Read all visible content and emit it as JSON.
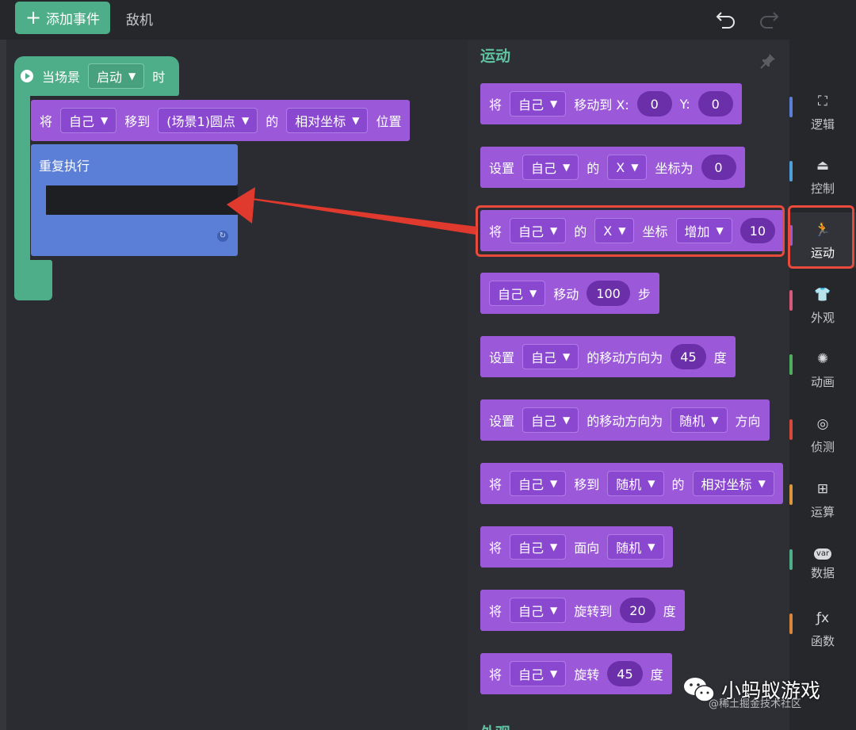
{
  "topbar": {
    "add_event_label": "添加事件",
    "sprite_tab": "敌机"
  },
  "workspace": {
    "event_block": {
      "prefix": "当场景",
      "dropdown": "启动",
      "suffix": "时"
    },
    "move_block": {
      "w1": "将",
      "target": "自己",
      "w2": "移到",
      "dest": "(场景1)圆点",
      "w3": "的",
      "coord": "相对坐标",
      "w4": "位置"
    },
    "repeat_block": {
      "label": "重复执行"
    }
  },
  "palette": {
    "title": "运动",
    "footer": "外观",
    "blocks": [
      {
        "parts": [
          {
            "t": "txt",
            "v": "将"
          },
          {
            "t": "dd",
            "v": "自己"
          },
          {
            "t": "txt",
            "v": "移动到 X:"
          },
          {
            "t": "num",
            "v": "0"
          },
          {
            "t": "txt",
            "v": "Y:"
          },
          {
            "t": "num",
            "v": "0"
          }
        ]
      },
      {
        "parts": [
          {
            "t": "txt",
            "v": "设置"
          },
          {
            "t": "dd",
            "v": "自己"
          },
          {
            "t": "txt",
            "v": "的"
          },
          {
            "t": "dd",
            "v": "X"
          },
          {
            "t": "txt",
            "v": "坐标为"
          },
          {
            "t": "num",
            "v": "0"
          }
        ]
      },
      {
        "parts": [
          {
            "t": "txt",
            "v": "将"
          },
          {
            "t": "dd",
            "v": "自己"
          },
          {
            "t": "txt",
            "v": "的"
          },
          {
            "t": "dd",
            "v": "X"
          },
          {
            "t": "txt",
            "v": "坐标"
          },
          {
            "t": "dd",
            "v": "增加"
          },
          {
            "t": "num",
            "v": "10"
          }
        ]
      },
      {
        "parts": [
          {
            "t": "dd",
            "v": "自己"
          },
          {
            "t": "txt",
            "v": "移动"
          },
          {
            "t": "num",
            "v": "100"
          },
          {
            "t": "txt",
            "v": "步"
          }
        ]
      },
      {
        "parts": [
          {
            "t": "txt",
            "v": "设置"
          },
          {
            "t": "dd",
            "v": "自己"
          },
          {
            "t": "txt",
            "v": "的移动方向为"
          },
          {
            "t": "num",
            "v": "45"
          },
          {
            "t": "txt",
            "v": "度"
          }
        ]
      },
      {
        "parts": [
          {
            "t": "txt",
            "v": "设置"
          },
          {
            "t": "dd",
            "v": "自己"
          },
          {
            "t": "txt",
            "v": "的移动方向为"
          },
          {
            "t": "dd",
            "v": "随机"
          },
          {
            "t": "txt",
            "v": "方向"
          }
        ]
      },
      {
        "parts": [
          {
            "t": "txt",
            "v": "将"
          },
          {
            "t": "dd",
            "v": "自己"
          },
          {
            "t": "txt",
            "v": "移到"
          },
          {
            "t": "dd",
            "v": "随机"
          },
          {
            "t": "txt",
            "v": "的"
          },
          {
            "t": "dd",
            "v": "相对坐标"
          }
        ]
      },
      {
        "parts": [
          {
            "t": "txt",
            "v": "将"
          },
          {
            "t": "dd",
            "v": "自己"
          },
          {
            "t": "txt",
            "v": "面向"
          },
          {
            "t": "dd",
            "v": "随机"
          }
        ]
      },
      {
        "parts": [
          {
            "t": "txt",
            "v": "将"
          },
          {
            "t": "dd",
            "v": "自己"
          },
          {
            "t": "txt",
            "v": "旋转到"
          },
          {
            "t": "num",
            "v": "20"
          },
          {
            "t": "txt",
            "v": "度"
          }
        ]
      },
      {
        "parts": [
          {
            "t": "txt",
            "v": "将"
          },
          {
            "t": "dd",
            "v": "自己"
          },
          {
            "t": "txt",
            "v": "旋转"
          },
          {
            "t": "num",
            "v": "45"
          },
          {
            "t": "txt",
            "v": "度"
          }
        ]
      }
    ]
  },
  "categories": [
    {
      "label": "逻辑",
      "icon": "tree-icon",
      "glyph": "⛶",
      "color": "#5b7fd6"
    },
    {
      "label": "控制",
      "icon": "stamp-icon",
      "glyph": "⏏",
      "color": "#4e9ed9"
    },
    {
      "label": "运动",
      "icon": "running-icon",
      "glyph": "🏃",
      "color": "#9b59d9",
      "active": true
    },
    {
      "label": "外观",
      "icon": "shirt-icon",
      "glyph": "👕",
      "color": "#d9597a"
    },
    {
      "label": "动画",
      "icon": "animation-icon",
      "glyph": "✺",
      "color": "#4fae5a"
    },
    {
      "label": "侦测",
      "icon": "radar-icon",
      "glyph": "◎",
      "color": "#d9493a"
    },
    {
      "label": "运算",
      "icon": "calculator-icon",
      "glyph": "⊞",
      "color": "#d9963a"
    },
    {
      "label": "数据",
      "icon": "var-icon",
      "glyph": "var",
      "color": "#4fae8a"
    },
    {
      "label": "函数",
      "icon": "function-icon",
      "glyph": "ƒx",
      "color": "#d9853a"
    }
  ],
  "watermark": {
    "name": "小蚂蚁游戏",
    "sub": "@稀土掘金技术社区"
  }
}
